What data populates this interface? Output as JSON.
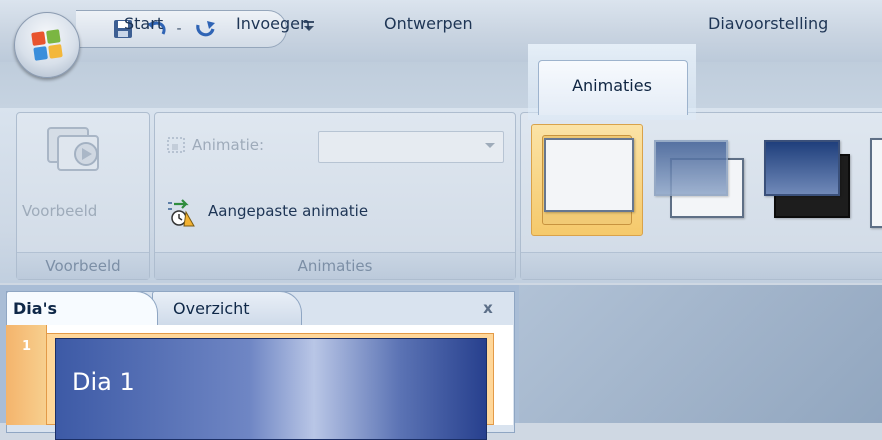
{
  "quick_access": {
    "icons": [
      "save-icon",
      "undo-icon",
      "redo-icon",
      "customize-icon"
    ],
    "undo_dropdown": "-"
  },
  "tabs": [
    "Start",
    "Invoegen",
    "Ontwerpen",
    "Animaties",
    "Diavoorstelling"
  ],
  "active_tab": "Animaties",
  "ribbon": {
    "voorbeeld": {
      "button_label": "Voorbeeld",
      "group_label": "Voorbeeld"
    },
    "animaties": {
      "animatie_label": "Animatie:",
      "animatie_value": "",
      "custom_animation": "Aangepaste animatie",
      "group_label": "Animaties"
    }
  },
  "pane": {
    "tabs": [
      "Dia's",
      "Overzicht"
    ],
    "close": "x",
    "slides": [
      {
        "number": "1",
        "title": "Dia 1"
      }
    ]
  },
  "colors": {
    "active_tab_bg": "#f7fafe",
    "selection_orange": "#f5c96b",
    "ribbon_bg": "#cdd8e5"
  }
}
